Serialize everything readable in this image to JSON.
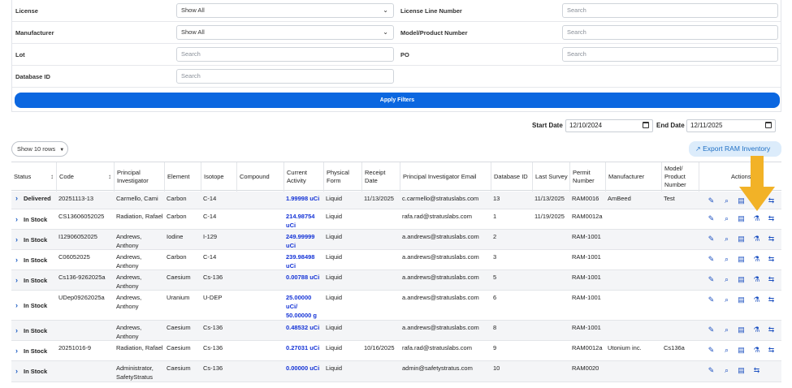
{
  "filters": {
    "license_label": "License",
    "license_value": "Show All",
    "license_line_label": "License Line Number",
    "license_line_placeholder": "Search",
    "manufacturer_label": "Manufacturer",
    "manufacturer_value": "Show All",
    "model_label": "Model/Product Number",
    "model_placeholder": "Search",
    "lot_label": "Lot",
    "lot_placeholder": "Search",
    "po_label": "PO",
    "po_placeholder": "Search",
    "dbid_label": "Database ID",
    "dbid_placeholder": "Search",
    "apply_label": "Apply Filters"
  },
  "dates": {
    "start_label": "Start Date",
    "start_value": "12/10/2024",
    "end_label": "End Date",
    "end_value": "12/11/2025"
  },
  "toolbar": {
    "show_rows_label": "Show 10 rows",
    "export_label": "Export RAM Inventory"
  },
  "table": {
    "headers": [
      "Status",
      "Code",
      "Principal Investigator",
      "Element",
      "Isotope",
      "Compound",
      "Current Activity",
      "Physical Form",
      "Receipt Date",
      "Principal Investigator Email",
      "Database ID",
      "Last Survey",
      "Permit Number",
      "Manufacturer",
      "Model/ Product Number",
      "Actions"
    ],
    "rows": [
      {
        "status": "Delivered",
        "code": "20251113-13",
        "pi": "Carmello, Cami",
        "element": "Carbon",
        "isotope": "C-14",
        "compound": "",
        "activity": "1.99998 uCi",
        "form": "Liquid",
        "receipt": "11/13/2025",
        "email": "c.carmello@stratuslabs.com",
        "dbid": "13",
        "survey": "11/13/2025",
        "permit": "RAM0016",
        "manufacturer": "AmBeed",
        "model": "Test"
      },
      {
        "status": "In Stock",
        "code": "CS13606052025",
        "pi": "Radiation, Rafael",
        "element": "Carbon",
        "isotope": "C-14",
        "compound": "",
        "activity": "214.98754 uCi",
        "form": "Liquid",
        "receipt": "",
        "email": "rafa.rad@stratuslabs.com",
        "dbid": "1",
        "survey": "11/19/2025",
        "permit": "RAM0012a",
        "manufacturer": "",
        "model": ""
      },
      {
        "status": "In Stock",
        "code": "I12906052025",
        "pi": "Andrews, Anthony",
        "element": "Iodine",
        "isotope": "I-129",
        "compound": "",
        "activity": "249.99999 uCi",
        "form": "Liquid",
        "receipt": "",
        "email": "a.andrews@stratuslabs.com",
        "dbid": "2",
        "survey": "",
        "permit": "RAM-1001",
        "manufacturer": "",
        "model": ""
      },
      {
        "status": "In Stock",
        "code": "C06052025",
        "pi": "Andrews, Anthony",
        "element": "Carbon",
        "isotope": "C-14",
        "compound": "",
        "activity": "239.98498 uCi",
        "form": "Liquid",
        "receipt": "",
        "email": "a.andrews@stratuslabs.com",
        "dbid": "3",
        "survey": "",
        "permit": "RAM-1001",
        "manufacturer": "",
        "model": ""
      },
      {
        "status": "In Stock",
        "code": "Cs136-9262025a",
        "pi": "Andrews, Anthony",
        "element": "Caesium",
        "isotope": "Cs-136",
        "compound": "",
        "activity": "0.00788 uCi",
        "form": "Liquid",
        "receipt": "",
        "email": "a.andrews@stratuslabs.com",
        "dbid": "5",
        "survey": "",
        "permit": "RAM-1001",
        "manufacturer": "",
        "model": ""
      },
      {
        "status": "In Stock",
        "code": "UDep09262025a",
        "pi": "Andrews, Anthony",
        "element": "Uranium",
        "isotope": "U-DEP",
        "compound": "",
        "activity": "25.00000 uCi/ 50.00000 g",
        "form": "Liquid",
        "receipt": "",
        "email": "a.andrews@stratuslabs.com",
        "dbid": "6",
        "survey": "",
        "permit": "RAM-1001",
        "manufacturer": "",
        "model": ""
      },
      {
        "status": "In Stock",
        "code": "",
        "pi": "Andrews, Anthony",
        "element": "Caesium",
        "isotope": "Cs-136",
        "compound": "",
        "activity": "0.48532 uCi",
        "form": "Liquid",
        "receipt": "",
        "email": "a.andrews@stratuslabs.com",
        "dbid": "8",
        "survey": "",
        "permit": "RAM-1001",
        "manufacturer": "",
        "model": ""
      },
      {
        "status": "In Stock",
        "code": "20251016-9",
        "pi": "Radiation, Rafael",
        "element": "Caesium",
        "isotope": "Cs-136",
        "compound": "",
        "activity": "0.27031 uCi",
        "form": "Liquid",
        "receipt": "10/16/2025",
        "email": "rafa.rad@stratuslabs.com",
        "dbid": "9",
        "survey": "",
        "permit": "RAM0012a",
        "manufacturer": "Utonium inc.",
        "model": "Cs136a"
      },
      {
        "status": "In Stock",
        "code": "",
        "pi": "Administrator, SafetyStratus",
        "element": "Caesium",
        "isotope": "Cs-136",
        "compound": "",
        "activity": "0.00000 uCi",
        "form": "Liquid",
        "receipt": "",
        "email": "admin@safetystratus.com",
        "dbid": "10",
        "survey": "",
        "permit": "RAM0020",
        "manufacturer": "",
        "model": ""
      }
    ]
  },
  "colors": {
    "primary": "#0b67e0",
    "activity": "#1433d6",
    "arrow": "#f2b227"
  }
}
